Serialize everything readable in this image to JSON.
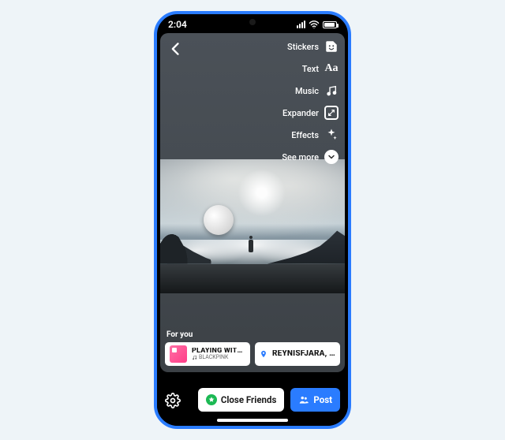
{
  "status": {
    "time": "2:04"
  },
  "tools": {
    "stickers": "Stickers",
    "text": "Text",
    "text_glyph": "Aa",
    "music": "Music",
    "expander": "Expander",
    "effects": "Effects",
    "see_more": "See more"
  },
  "for_you": {
    "heading": "For you",
    "music_chip": {
      "title": "PLAYING WITH FIRE",
      "artist": "BLACKPINK"
    },
    "location_chip": {
      "title": "REYNISFJARA, ICELAND"
    }
  },
  "bottom": {
    "close_friends": "Close Friends",
    "post": "Post"
  }
}
